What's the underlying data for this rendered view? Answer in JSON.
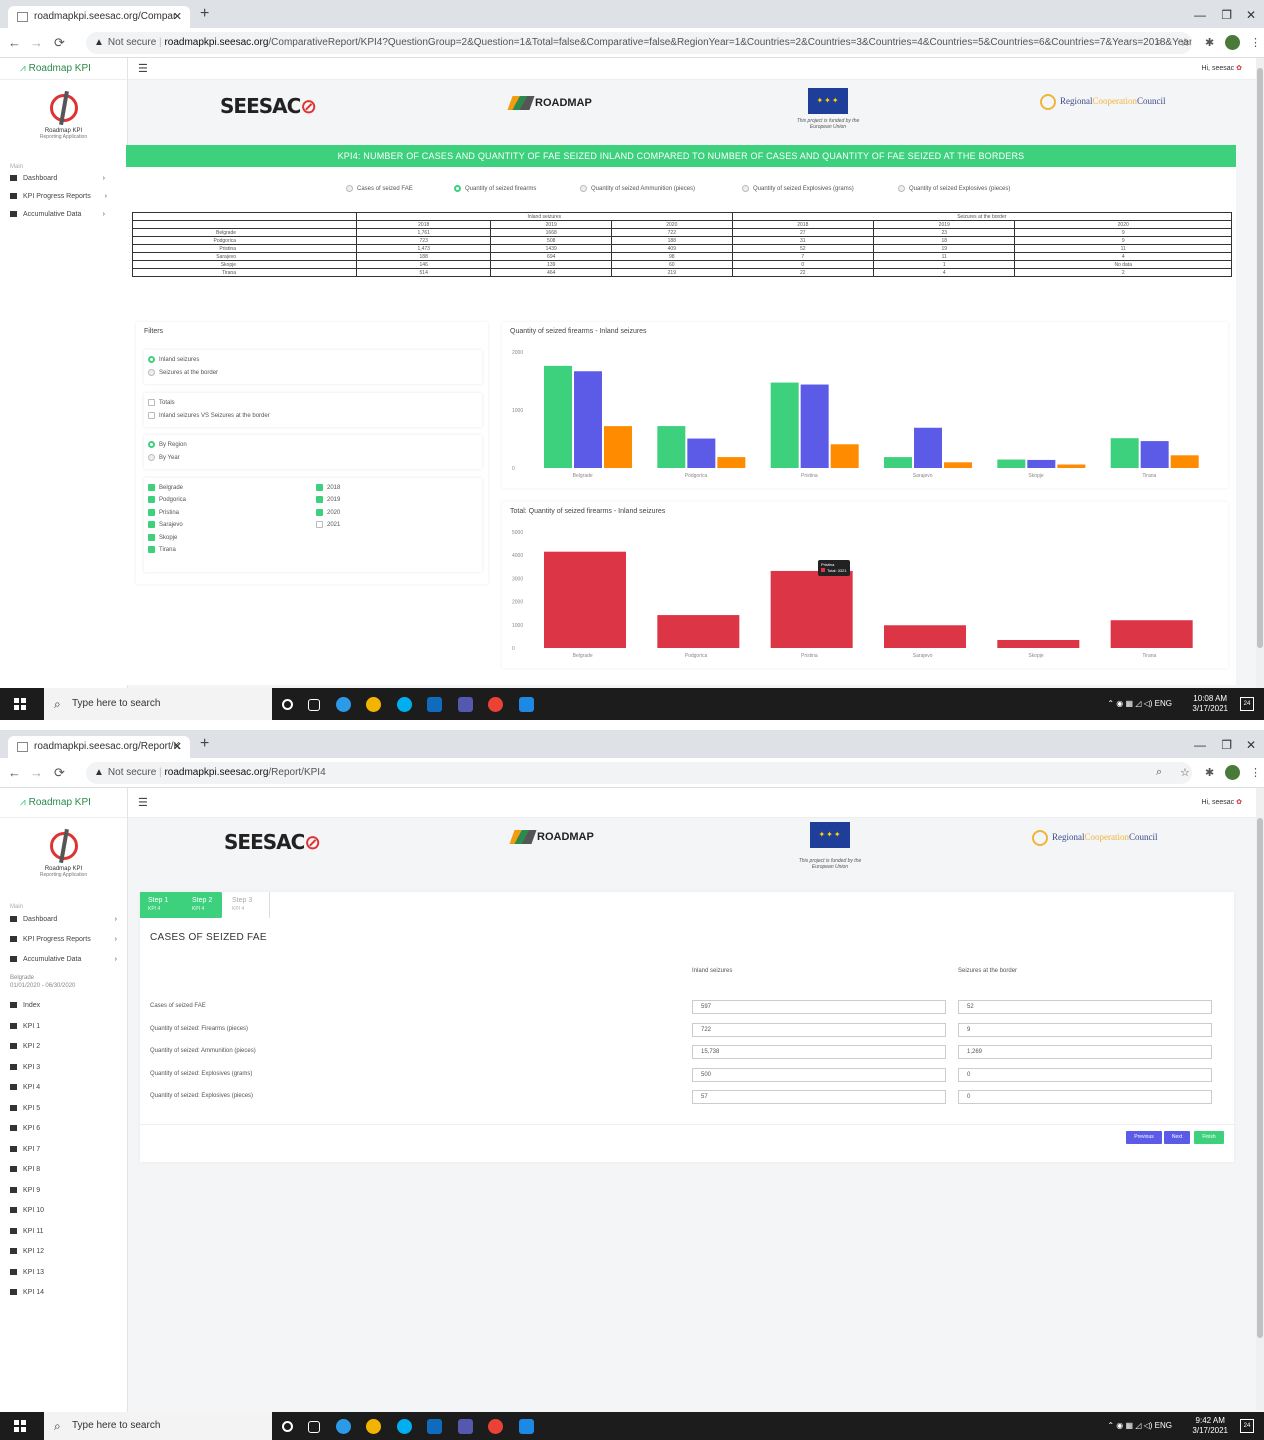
{
  "shot1": {
    "tab_title": "roadmapkpi.seesac.org/Compar",
    "url_warning": "Not secure",
    "url_host": "roadmapkpi.seesac.org",
    "url_path": "/ComparativeReport/KPI4?QuestionGroup=2&Question=1&Total=false&Comparative=false&RegionYear=1&Countries=2&Countries=3&Countries=4&Countries=5&Countries=6&Countries=7&Years=2018&Years=2019...",
    "report_title": "KPI4: NUMBER OF CASES AND QUANTITY OF FAE SEIZED INLAND COMPARED TO NUMBER OF CASES AND QUANTITY OF FAE SEIZED AT THE BORDERS",
    "question_options": [
      {
        "label": "Cases of seized FAE",
        "selected": false
      },
      {
        "label": "Quantity of seized firearms",
        "selected": true
      },
      {
        "label": "Quantity of seized Ammunition (pieces)",
        "selected": false
      },
      {
        "label": "Quantity of seized Explosives (grams)",
        "selected": false
      },
      {
        "label": "Quantity of seized Explosives (pieces)",
        "selected": false
      }
    ],
    "table": {
      "group_headers": [
        "Inland seizures",
        "Seizures at the border"
      ],
      "years": [
        "2018",
        "2019",
        "2020",
        "2018",
        "2019",
        "2020"
      ],
      "rows": [
        {
          "city": "Belgrade",
          "values": [
            "1,761",
            "1668",
            "722",
            "27",
            "23",
            "9"
          ]
        },
        {
          "city": "Podgorica",
          "values": [
            "723",
            "508",
            "188",
            "31",
            "18",
            "9"
          ]
        },
        {
          "city": "Pristina",
          "values": [
            "1,473",
            "1439",
            "409",
            "52",
            "19",
            "11"
          ]
        },
        {
          "city": "Sarajevo",
          "values": [
            "188",
            "694",
            "98",
            "7",
            "11",
            "4"
          ]
        },
        {
          "city": "Skopje",
          "values": [
            "146",
            "139",
            "60",
            "0",
            "1",
            "No data"
          ]
        },
        {
          "city": "Tirana",
          "values": [
            "514",
            "464",
            "219",
            "22",
            "4",
            "2"
          ]
        }
      ]
    },
    "filters": {
      "title": "Filters",
      "seizure_type": [
        {
          "label": "Inland seizures",
          "selected": true
        },
        {
          "label": "Seizures at the border",
          "selected": false
        }
      ],
      "extra": [
        {
          "label": "Totals",
          "checked": false
        },
        {
          "label": "Inland seizures VS Seizures at the border",
          "checked": false
        }
      ],
      "grouping": [
        {
          "label": "By Region",
          "selected": true
        },
        {
          "label": "By Year",
          "selected": false
        }
      ],
      "regions": [
        {
          "label": "Belgrade",
          "checked": true
        },
        {
          "label": "Podgorica",
          "checked": true
        },
        {
          "label": "Pristina",
          "checked": true
        },
        {
          "label": "Sarajevo",
          "checked": true
        },
        {
          "label": "Skopje",
          "checked": true
        },
        {
          "label": "Tirana",
          "checked": true
        }
      ],
      "years": [
        {
          "label": "2018",
          "checked": true
        },
        {
          "label": "2019",
          "checked": true
        },
        {
          "label": "2020",
          "checked": true
        },
        {
          "label": "2021",
          "checked": false
        }
      ]
    },
    "clock_time": "10:08 AM",
    "clock_date": "3/17/2021"
  },
  "chart_data": [
    {
      "type": "bar",
      "title": "Quantity of seized firearms - Inland seizures",
      "categories": [
        "Belgrade",
        "Podgorica",
        "Pristina",
        "Sarajevo",
        "Skopje",
        "Tirana"
      ],
      "series": [
        {
          "values": [
            1761,
            723,
            1473,
            188,
            146,
            514
          ],
          "color": "#3dd17e"
        },
        {
          "values": [
            1668,
            508,
            1439,
            694,
            139,
            464
          ],
          "color": "#5b5be8"
        },
        {
          "values": [
            722,
            188,
            409,
            98,
            60,
            219
          ],
          "color": "#ff8c00"
        }
      ],
      "ylim": [
        0,
        2000
      ],
      "yticks": [
        "0",
        "1000",
        "2000"
      ]
    },
    {
      "type": "bar",
      "title": "Total: Quantity of seized firearms - Inland seizures",
      "categories": [
        "Belgrade",
        "Podgorica",
        "Pristina",
        "Sarajevo",
        "Skopje",
        "Tirana"
      ],
      "values": [
        4151,
        1419,
        3321,
        980,
        345,
        1197
      ],
      "color": "#dc3545",
      "ylim": [
        0,
        5000
      ],
      "yticks": [
        "0",
        "1000",
        "2000",
        "3000",
        "4000",
        "5000"
      ],
      "tooltip": {
        "category": "Pristina",
        "text": "Total: 3321"
      }
    }
  ],
  "shot2": {
    "tab_title": "roadmapkpi.seesac.org/Report/K",
    "url_warning": "Not secure",
    "url_host": "roadmapkpi.seesac.org",
    "url_path": "/Report/KPI4",
    "steps": [
      {
        "label": "Step 1",
        "sub": "KPI 4"
      },
      {
        "label": "Step 2",
        "sub": "KPI 4"
      },
      {
        "label": "Step 3",
        "sub": "KPI 4"
      }
    ],
    "form_title": "CASES OF SEIZED FAE",
    "col_inland": "Inland seizures",
    "col_border": "Seizures at the border",
    "rows": [
      {
        "label": "Cases of seized FAE",
        "inland": "597",
        "border": "52"
      },
      {
        "label": "Quantity of seized: Firearms (pieces)",
        "inland": "722",
        "border": "9"
      },
      {
        "label": "Quantity of seized: Ammunition (pieces)",
        "inland": "15,738",
        "border": "1,269"
      },
      {
        "label": "Quantity of seized: Explosives (grams)",
        "inland": "500",
        "border": "0"
      },
      {
        "label": "Quantity of seized: Explosives (pieces)",
        "inland": "57",
        "border": "0"
      }
    ],
    "buttons": {
      "previous": "Previous",
      "next": "Next",
      "finish": "Finish"
    },
    "sidebar_period_city": "Belgrade",
    "sidebar_period_dates": "01/01/2020 - 06/30/2020",
    "kpi_items": [
      "Index",
      "KPI 1",
      "KPI 2",
      "KPI 3",
      "KPI 4",
      "KPI 5",
      "KPI 6",
      "KPI 7",
      "KPI 8",
      "KPI 9",
      "KPI 10",
      "KPI 11",
      "KPI 12",
      "KPI 13",
      "KPI 14"
    ],
    "clock_time": "9:42 AM",
    "clock_date": "3/17/2021"
  },
  "common": {
    "app_name": "Roadmap KPI",
    "logo_title": "Roadmap KPI",
    "logo_sub": "Reporting Application",
    "side_section": "Main",
    "menu": [
      "Dashboard",
      "KPI Progress Reports",
      "Accumulative Data"
    ],
    "greeting": "Hi, seesac",
    "seesac_logo": "SEESAC",
    "roadmap_logo": "ROADMAP",
    "eu_caption": "This project is funded by the European Union",
    "rcc_1": "Regional",
    "rcc_2": "Cooperation",
    "rcc_3": "Council",
    "taskbar_search": "Type here to search",
    "tray_lang": "ENG",
    "notif_count": "24"
  },
  "colors": {
    "accent": "#3dd17e",
    "series1": "#3dd17e",
    "series2": "#5b5be8",
    "series3": "#ff8c00",
    "total": "#dc3545",
    "button": "#5b5be8"
  },
  "icons": [
    "back-icon",
    "forward-icon",
    "reload-icon",
    "warning-icon",
    "zoom-icon",
    "star-icon",
    "extensions-icon",
    "menu-icon",
    "hamburger-icon",
    "gear-icon",
    "dashboard-icon",
    "grid-icon",
    "windows-icon",
    "search-icon"
  ]
}
